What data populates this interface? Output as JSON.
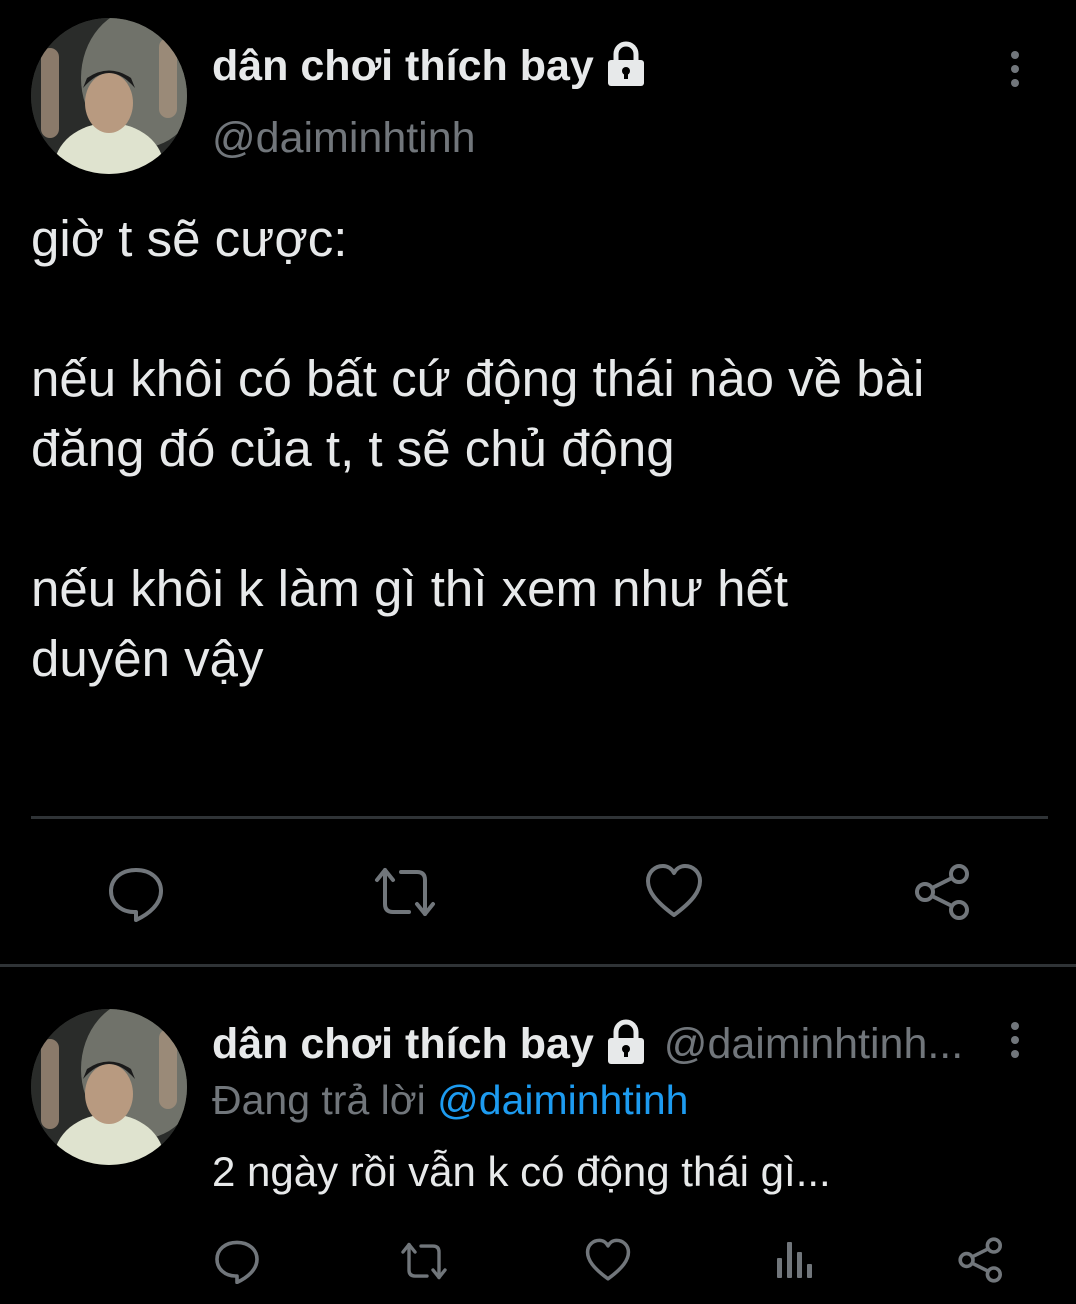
{
  "main_tweet": {
    "display_name": "dân chơi thích bay",
    "handle": "@daiminhtinh",
    "text": "giờ t sẽ cược:\n\nnếu khôi có bất cứ động thái nào về bài\nđăng đó của t, t sẽ chủ động\n\nnếu khôi k làm gì thì xem như hết\nduyên vậy",
    "icons": [
      "lock-icon",
      "more-icon",
      "reply-icon",
      "retweet-icon",
      "like-icon",
      "share-icon"
    ]
  },
  "reply_tweet": {
    "display_name": "dân chơi thích bay",
    "handle": "@daiminhtinh...",
    "replying_prefix": "Đang trả lời",
    "replying_handle": "@daiminhtinh",
    "text": "2 ngày rồi vẫn k có động thái gì...",
    "icons": [
      "lock-icon",
      "more-icon",
      "reply-icon",
      "retweet-icon",
      "like-icon",
      "analytics-icon",
      "share-icon"
    ]
  },
  "colors": {
    "background": "#000000",
    "text": "#e7e9ea",
    "secondary": "#71767b",
    "link": "#1d9bf0",
    "divider": "#2f3336"
  }
}
